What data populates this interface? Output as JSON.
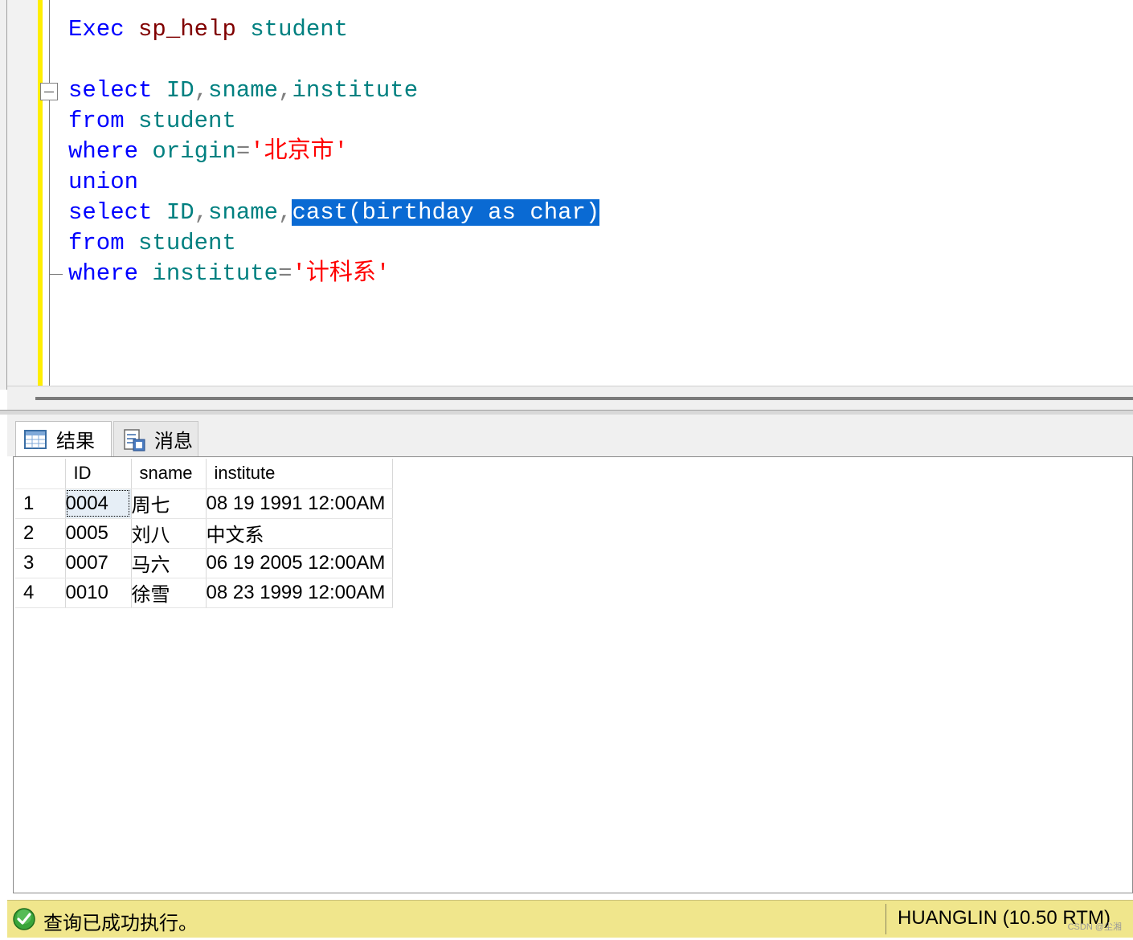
{
  "editor": {
    "lines": [
      [
        {
          "t": "Exec",
          "c": "kw"
        },
        {
          "t": " "
        },
        {
          "t": "sp_help",
          "c": "sp"
        },
        {
          "t": " "
        },
        {
          "t": "student",
          "c": "id"
        }
      ],
      [],
      [
        {
          "t": "select",
          "c": "kw"
        },
        {
          "t": " "
        },
        {
          "t": "ID",
          "c": "id"
        },
        {
          "t": ",",
          "c": "op"
        },
        {
          "t": "sname",
          "c": "id"
        },
        {
          "t": ",",
          "c": "op"
        },
        {
          "t": "institute",
          "c": "id"
        }
      ],
      [
        {
          "t": "from",
          "c": "kw"
        },
        {
          "t": " "
        },
        {
          "t": "student",
          "c": "id"
        }
      ],
      [
        {
          "t": "where",
          "c": "kw"
        },
        {
          "t": " "
        },
        {
          "t": "origin",
          "c": "id"
        },
        {
          "t": "=",
          "c": "op"
        },
        {
          "t": "'北京市'",
          "c": "str"
        }
      ],
      [
        {
          "t": "union",
          "c": "kw"
        }
      ],
      [
        {
          "t": "select",
          "c": "kw"
        },
        {
          "t": " "
        },
        {
          "t": "ID",
          "c": "id"
        },
        {
          "t": ",",
          "c": "op"
        },
        {
          "t": "sname",
          "c": "id"
        },
        {
          "t": ",",
          "c": "op"
        },
        {
          "t": "cast(birthday as char)",
          "c": "sel"
        }
      ],
      [
        {
          "t": "from",
          "c": "kw"
        },
        {
          "t": " "
        },
        {
          "t": "student",
          "c": "id"
        }
      ],
      [
        {
          "t": "where",
          "c": "kw"
        },
        {
          "t": " "
        },
        {
          "t": "institute",
          "c": "id"
        },
        {
          "t": "=",
          "c": "op"
        },
        {
          "t": "'计科系'",
          "c": "str"
        }
      ]
    ]
  },
  "tabs": {
    "results_label": "结果",
    "messages_label": "消息"
  },
  "grid": {
    "columns": [
      "ID",
      "sname",
      "institute"
    ],
    "rows": [
      {
        "num": "1",
        "cells": [
          "0004",
          "周七",
          "08 19 1991 12:00AM"
        ]
      },
      {
        "num": "2",
        "cells": [
          "0005",
          "刘八",
          "中文系"
        ]
      },
      {
        "num": "3",
        "cells": [
          "0007",
          "马六",
          "06 19 2005 12:00AM"
        ]
      },
      {
        "num": "4",
        "cells": [
          "0010",
          "徐雪",
          "08 23 1999 12:00AM"
        ]
      }
    ]
  },
  "status": {
    "message": "查询已成功执行。",
    "server": "HUANGLIN (10.50 RTM)",
    "watermark": "CSDN @尘湘"
  },
  "colors": {
    "keyword": "#0000ff",
    "identifier": "#008080",
    "string": "#ff0000",
    "system_proc": "#800000",
    "selection": "#0a6ad3",
    "status_bar": "#f0e68c"
  }
}
